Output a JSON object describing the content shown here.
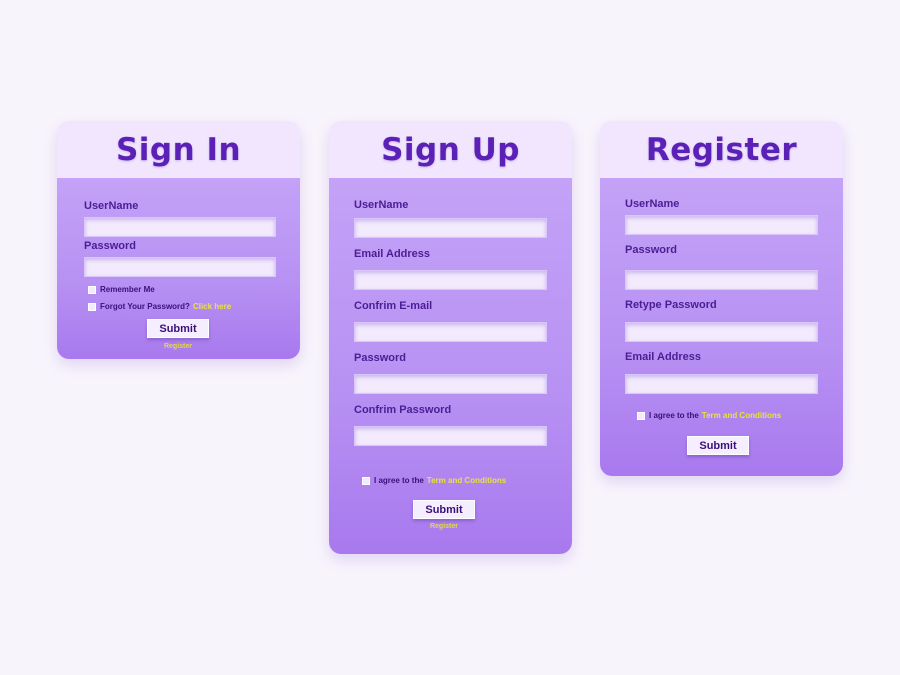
{
  "signin": {
    "title": "Sign In",
    "username_label": "UserName",
    "password_label": "Password",
    "remember_label": "Remember Me",
    "forgot_label": "Forgot Your Password?",
    "forgot_link": "Click here",
    "submit_label": "Submit",
    "register_link": "Register"
  },
  "signup": {
    "title": "Sign Up",
    "username_label": "UserName",
    "email_label": "Email Address",
    "confirm_email_label": "Confrim E-mail",
    "password_label": "Password",
    "confirm_password_label": "Confrim Password",
    "agree_label": "I agree to the",
    "terms_link": "Term and Conditions",
    "submit_label": "Submit",
    "register_link": "Register"
  },
  "register": {
    "title": "Register",
    "username_label": "UserName",
    "password_label": "Password",
    "retype_label": "Retype Password",
    "email_label": "Email Address",
    "agree_label": "I agree to the",
    "terms_link": "Term and Conditions",
    "submit_label": "Submit"
  },
  "colors": {
    "background": "#f8f4fc",
    "header": "#f1e6fd",
    "body": "#b892f3",
    "title": "#5b21b6",
    "link": "#e8e23a"
  }
}
